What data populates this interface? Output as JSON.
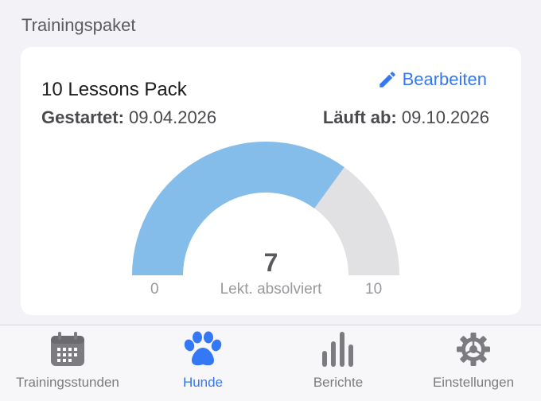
{
  "section": {
    "title": "Trainingspaket"
  },
  "card": {
    "title": "10 Lessons Pack",
    "edit_label": "Bearbeiten",
    "started_label": "Gestartet:",
    "started_value": "09.04.2026",
    "expires_label": "Läuft ab:",
    "expires_value": "09.10.2026"
  },
  "gauge": {
    "value": "7",
    "caption": "Lekt. absolviert",
    "min": "0",
    "max": "10",
    "completed": 7,
    "total": 10,
    "fill_color": "#85bdea",
    "track_color": "#e1e1e3"
  },
  "tabbar": {
    "items": [
      {
        "label": "Trainingsstunden",
        "icon": "calendar-icon",
        "active": false
      },
      {
        "label": "Hunde",
        "icon": "paw-icon",
        "active": true
      },
      {
        "label": "Berichte",
        "icon": "bar-chart-icon",
        "active": false
      },
      {
        "label": "Einstellungen",
        "icon": "gear-icon",
        "active": false
      }
    ],
    "active_color": "#3478f6",
    "inactive_color": "#7b7b80"
  }
}
